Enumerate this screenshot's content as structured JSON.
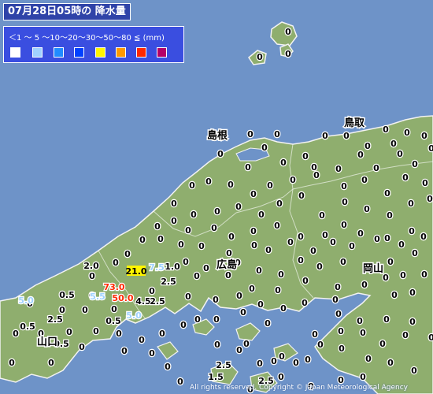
{
  "title": "07月28日05時の 降水量",
  "legend": {
    "scale_text": "＜1 ～ 5 ～10～20～30～50～80 ≦ (mm)",
    "colors": [
      "#ffffff",
      "#a0d2ff",
      "#218cff",
      "#0041ff",
      "#fff500",
      "#ff9900",
      "#ff2800",
      "#b40068"
    ]
  },
  "colors": {
    "sea": "#6e93c8",
    "land": "#8fae6e",
    "coast": "#f2f2f2",
    "zero_marker": "#000000",
    "light": "#a0d2ff",
    "moderate": "#fff500",
    "heavy": "#ff2800"
  },
  "regions": [
    {
      "name": "島根"
    },
    {
      "name": "鳥取"
    },
    {
      "name": "広島"
    },
    {
      "name": "岡山"
    },
    {
      "name": "山口"
    }
  ],
  "stations_zero": [
    [
      366,
      40
    ],
    [
      330,
      72
    ],
    [
      366,
      68
    ],
    [
      318,
      170
    ],
    [
      352,
      170
    ],
    [
      388,
      198
    ],
    [
      413,
      172
    ],
    [
      440,
      172
    ],
    [
      467,
      185
    ],
    [
      490,
      164
    ],
    [
      517,
      168
    ],
    [
      539,
      172
    ],
    [
      500,
      182
    ],
    [
      280,
      195
    ],
    [
      315,
      212
    ],
    [
      336,
      187
    ],
    [
      360,
      206
    ],
    [
      399,
      212
    ],
    [
      430,
      214
    ],
    [
      458,
      196
    ],
    [
      478,
      213
    ],
    [
      508,
      195
    ],
    [
      527,
      208
    ],
    [
      548,
      188
    ],
    [
      244,
      235
    ],
    [
      265,
      230
    ],
    [
      293,
      234
    ],
    [
      322,
      246
    ],
    [
      343,
      235
    ],
    [
      372,
      228
    ],
    [
      402,
      222
    ],
    [
      437,
      236
    ],
    [
      463,
      228
    ],
    [
      492,
      245
    ],
    [
      515,
      225
    ],
    [
      540,
      232
    ],
    [
      221,
      258
    ],
    [
      246,
      272
    ],
    [
      276,
      268
    ],
    [
      303,
      262
    ],
    [
      332,
      272
    ],
    [
      355,
      258
    ],
    [
      383,
      248
    ],
    [
      409,
      273
    ],
    [
      438,
      256
    ],
    [
      466,
      265
    ],
    [
      495,
      273
    ],
    [
      522,
      258
    ],
    [
      546,
      252
    ],
    [
      200,
      287
    ],
    [
      221,
      280
    ],
    [
      239,
      292
    ],
    [
      272,
      289
    ],
    [
      294,
      300
    ],
    [
      322,
      293
    ],
    [
      352,
      286
    ],
    [
      382,
      300
    ],
    [
      413,
      298
    ],
    [
      437,
      285
    ],
    [
      458,
      296
    ],
    [
      492,
      302
    ],
    [
      523,
      293
    ],
    [
      181,
      304
    ],
    [
      204,
      303
    ],
    [
      230,
      310
    ],
    [
      256,
      312
    ],
    [
      291,
      321
    ],
    [
      323,
      311
    ],
    [
      341,
      317
    ],
    [
      369,
      307
    ],
    [
      398,
      318
    ],
    [
      423,
      307
    ],
    [
      447,
      312
    ],
    [
      479,
      303
    ],
    [
      510,
      310
    ],
    [
      538,
      300
    ],
    [
      162,
      322
    ],
    [
      147,
      333
    ],
    [
      236,
      332
    ],
    [
      262,
      340
    ],
    [
      302,
      333
    ],
    [
      329,
      343
    ],
    [
      357,
      348
    ],
    [
      382,
      330
    ],
    [
      406,
      338
    ],
    [
      436,
      332
    ],
    [
      496,
      332
    ],
    [
      527,
      321
    ],
    [
      117,
      350
    ],
    [
      250,
      350
    ],
    [
      290,
      349
    ],
    [
      320,
      366
    ],
    [
      353,
      368
    ],
    [
      388,
      356
    ],
    [
      429,
      364
    ],
    [
      463,
      361
    ],
    [
      490,
      352
    ],
    [
      512,
      349
    ],
    [
      539,
      348
    ],
    [
      117,
      375
    ],
    [
      193,
      369
    ],
    [
      239,
      376
    ],
    [
      274,
      380
    ],
    [
      304,
      375
    ],
    [
      331,
      386
    ],
    [
      360,
      391
    ],
    [
      387,
      384
    ],
    [
      426,
      380
    ],
    [
      501,
      374
    ],
    [
      524,
      371
    ],
    [
      38,
      385
    ],
    [
      79,
      393
    ],
    [
      108,
      393
    ],
    [
      145,
      392
    ],
    [
      251,
      405
    ],
    [
      275,
      405
    ],
    [
      309,
      396
    ],
    [
      340,
      410
    ],
    [
      430,
      398
    ],
    [
      457,
      407
    ],
    [
      491,
      405
    ],
    [
      524,
      408
    ],
    [
      20,
      423
    ],
    [
      52,
      423
    ],
    [
      88,
      421
    ],
    [
      122,
      420
    ],
    [
      151,
      423
    ],
    [
      180,
      431
    ],
    [
      206,
      423
    ],
    [
      233,
      412
    ],
    [
      313,
      436
    ],
    [
      400,
      424
    ],
    [
      433,
      420
    ],
    [
      486,
      436
    ],
    [
      461,
      422
    ],
    [
      515,
      425
    ],
    [
      548,
      428
    ],
    [
      15,
      460
    ],
    [
      65,
      460
    ],
    [
      104,
      440
    ],
    [
      158,
      445
    ],
    [
      193,
      448
    ],
    [
      213,
      465
    ],
    [
      276,
      437
    ],
    [
      304,
      444
    ],
    [
      330,
      461
    ],
    [
      358,
      452
    ],
    [
      391,
      456
    ],
    [
      434,
      442
    ],
    [
      468,
      455
    ],
    [
      496,
      460
    ],
    [
      526,
      470
    ],
    [
      433,
      482
    ],
    [
      461,
      478
    ],
    [
      357,
      478
    ],
    [
      376,
      460
    ],
    [
      229,
      484
    ],
    [
      395,
      490
    ],
    [
      407,
      437
    ],
    [
      348,
      458
    ],
    [
      318,
      494
    ]
  ],
  "stations_value": [
    {
      "v": "2.0",
      "kind": "dark"
    },
    {
      "v": "21.0",
      "kind": "moderate"
    },
    {
      "v": "7.5",
      "kind": "light"
    },
    {
      "v": "1.0",
      "kind": "dark"
    },
    {
      "v": "2.5",
      "kind": "dark"
    },
    {
      "v": "73.0",
      "kind": "heavy"
    },
    {
      "v": "50.0",
      "kind": "heavy"
    },
    {
      "v": "5.5",
      "kind": "light"
    },
    {
      "v": "0.5",
      "kind": "dark"
    },
    {
      "v": "5.0",
      "kind": "light"
    },
    {
      "v": "4.5",
      "kind": "dark"
    },
    {
      "v": "2.5",
      "kind": "dark"
    },
    {
      "v": "5.0",
      "kind": "light"
    },
    {
      "v": "0.5",
      "kind": "dark"
    },
    {
      "v": "0.5",
      "kind": "dark"
    },
    {
      "v": "2.5",
      "kind": "dark"
    },
    {
      "v": "0.5",
      "kind": "dark"
    },
    {
      "v": "2.5",
      "kind": "dark"
    },
    {
      "v": "1.5",
      "kind": "dark"
    },
    {
      "v": "2.5",
      "kind": "dark"
    }
  ],
  "copyright": "All rights reserved. Copyright © Japan Meteorological Agency"
}
